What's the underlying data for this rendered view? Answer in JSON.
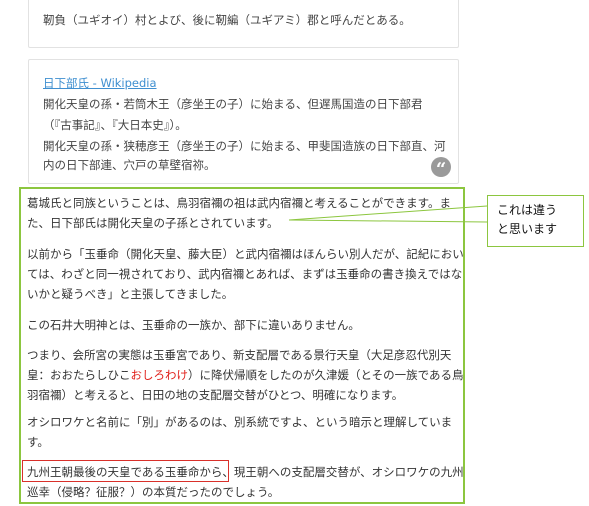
{
  "quote1": {
    "line": "靭負（ユギオイ）村とよび、後に靭編（ユギアミ）郡と呼んだとある。"
  },
  "quote2": {
    "link": "日下部氏 - Wikipedia",
    "lines": [
      "開化天皇の孫・若筒木王（彦坐王の子）に始まる、但遅馬国造の日下部君",
      "（『古事記』、『大日本史』）。",
      "開化天皇の孫・狭穂彦王（彦坐王の子）に始まる、甲斐国造族の日下部直、河",
      "内の日下部連、穴戸の草壁宿祢。"
    ],
    "quote_icon": "quote-icon"
  },
  "article": {
    "p1": [
      "葛城氏と同族ということは、鳥羽宿禰の祖は武内宿禰と考えることができます。ま",
      "た、日下部氏は開化天皇の子孫とされています。"
    ],
    "p2": [
      "以前から「玉垂命（開化天皇、藤大臣）と武内宿禰はほんらい別人だが、記紀におい",
      "ては、わざと同一視されており、武内宿禰とあれば、まずは玉垂命の書き換えではな",
      "いかと疑うべき」と主張してきました。"
    ],
    "p3": [
      "この石井大明神とは、玉垂命の一族か、部下に違いありません。"
    ],
    "p4": {
      "line1": "つまり、会所宮の実態は玉垂宮であり、新支配層である景行天皇（大足彦忍代別天",
      "line2_before": "皇：おおたらしひこ",
      "line2_red": "おしろわけ",
      "line2_after": "）に降伏帰順をしたのが久津媛（とその一族である鳥",
      "line3": "羽宿禰）と考えると、日田の地の支配層交替がひとつ、明確になります。"
    },
    "p5": [
      "オシロワケと名前に「別」があるのは、別系統ですよ、という暗示と理解していま",
      "す。"
    ],
    "p6": [
      "九州王朝最後の天皇である玉垂命から、現王朝への支配層交替が、オシロワケの九州",
      "巡幸（侵略？征服？）の本質だったのでしょう。"
    ]
  },
  "callout": {
    "lines": [
      "これは違う",
      "と思います"
    ]
  },
  "colors": {
    "annotation_green": "#8cc63f",
    "annotation_red": "#d9302a",
    "link_blue": "#3f8fd0",
    "red_text": "#e0201b"
  }
}
